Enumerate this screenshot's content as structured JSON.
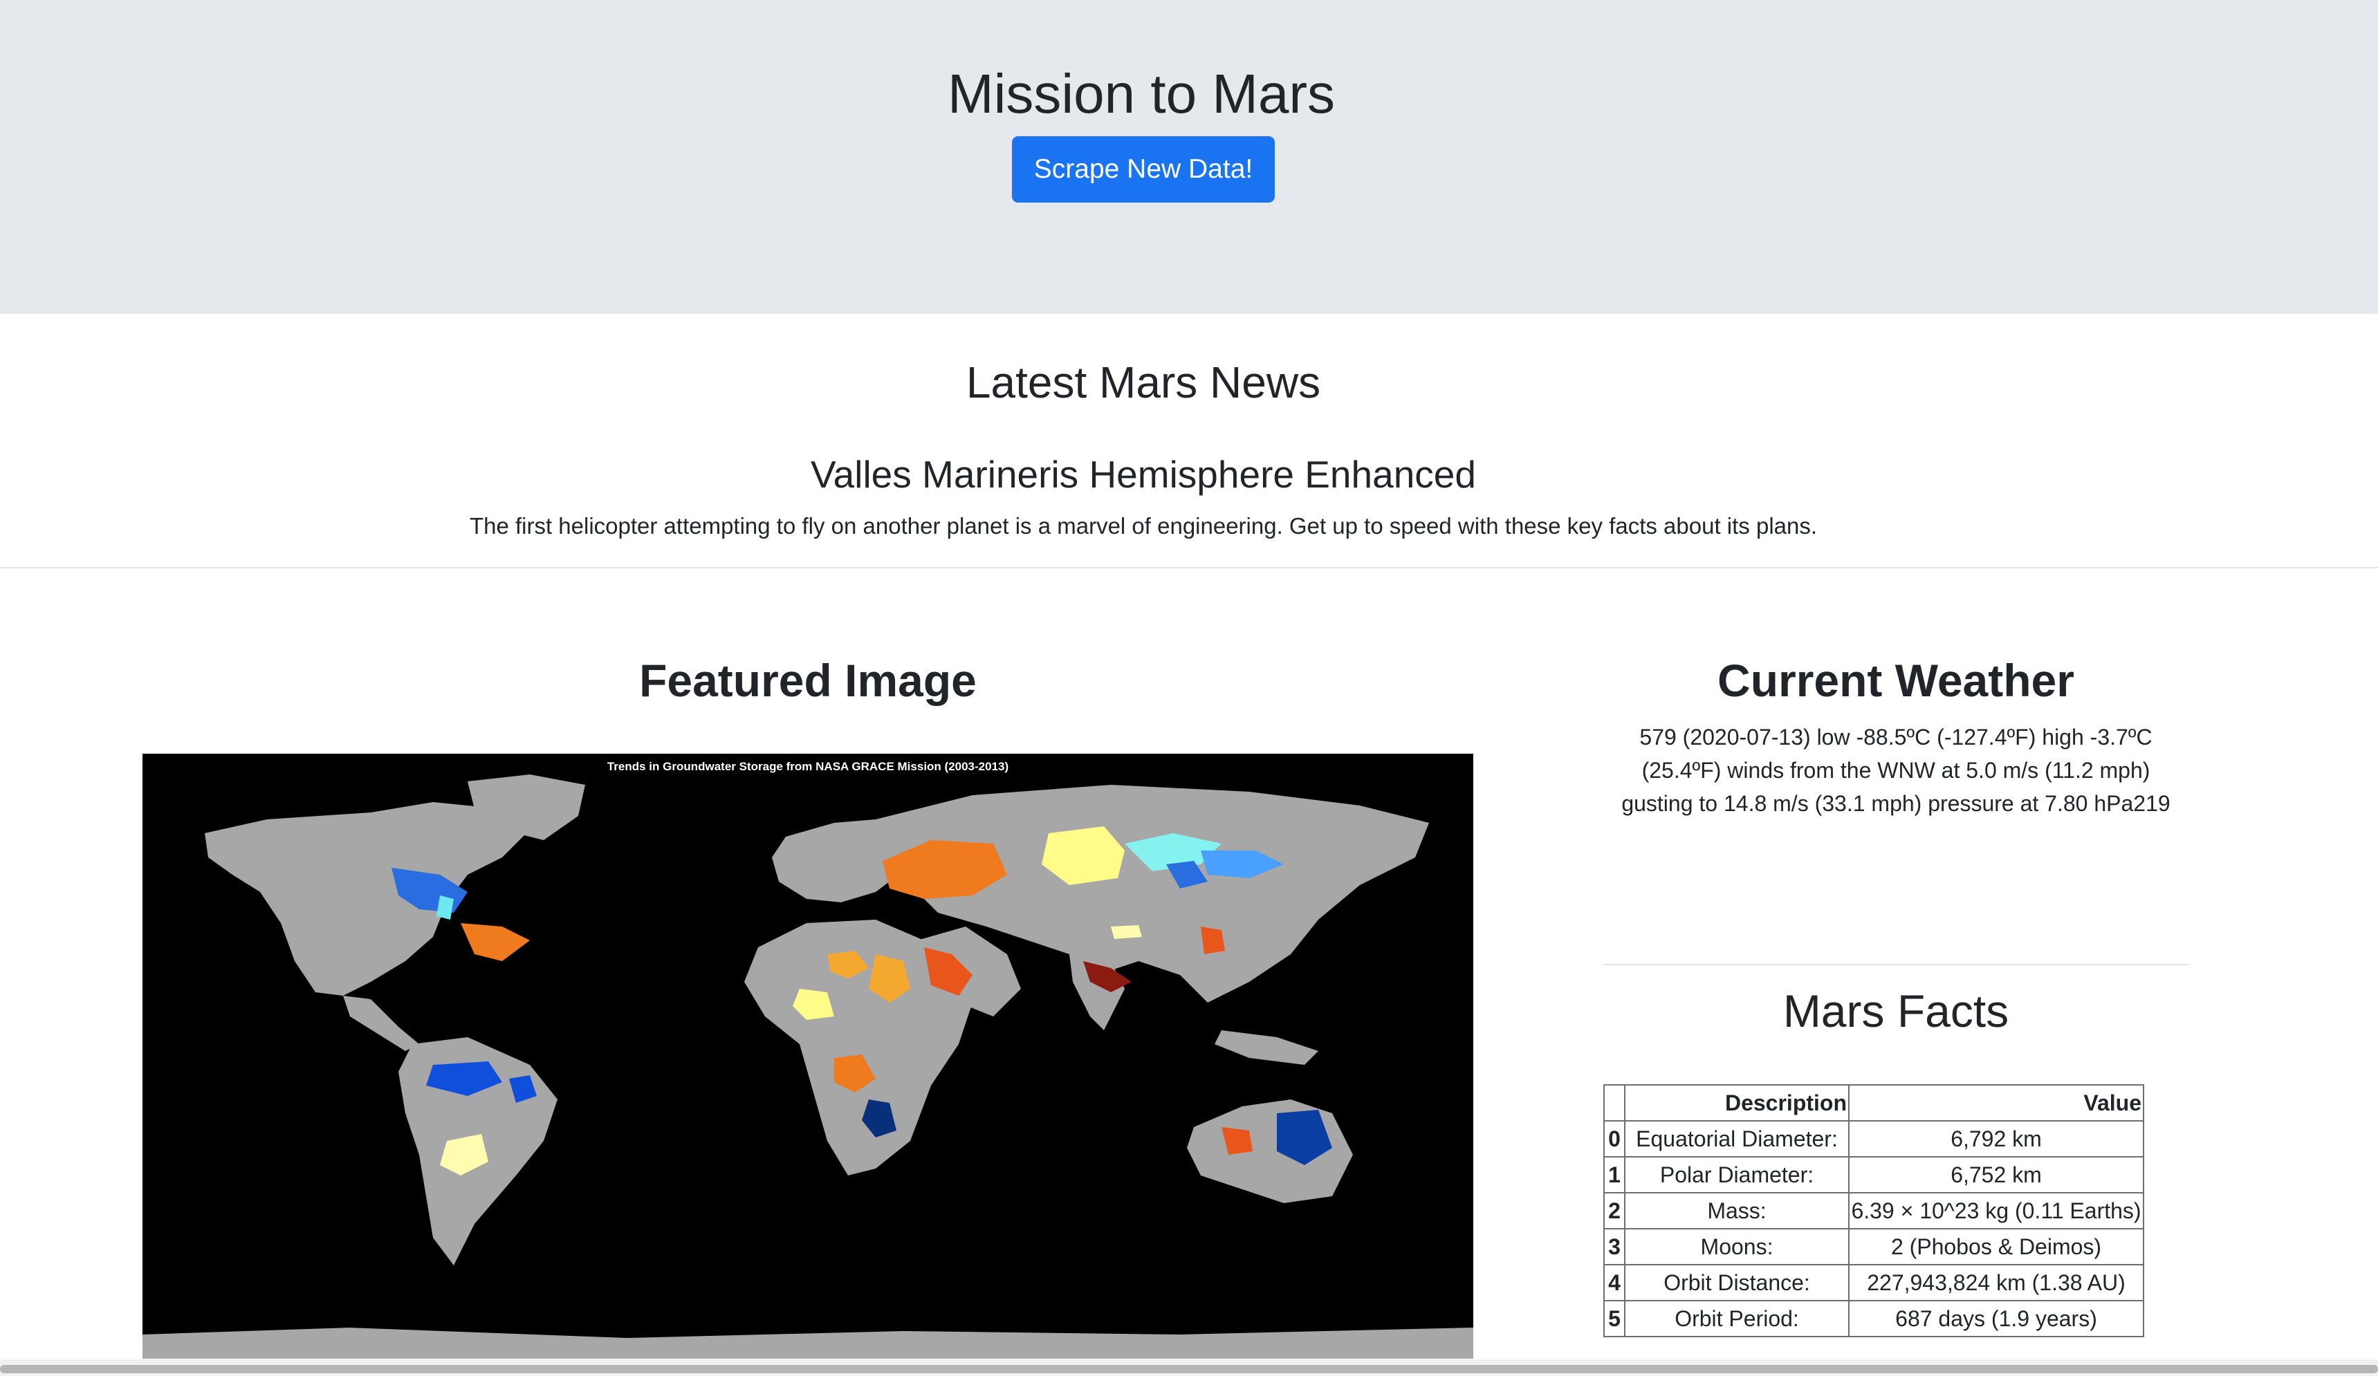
{
  "header": {
    "title": "Mission to Mars",
    "scrape_button": "Scrape New Data!"
  },
  "news": {
    "heading": "Latest Mars News",
    "title": "Valles Marineris Hemisphere Enhanced",
    "teaser": "The first helicopter attempting to fly on another planet is a marvel of engineering. Get up to speed with these key facts about its plans."
  },
  "featured": {
    "heading": "Featured Image",
    "image_caption": "Trends in Groundwater Storage from NASA GRACE Mission (2003-2013)"
  },
  "weather": {
    "heading": "Current Weather",
    "text": "579 (2020-07-13) low -88.5ºC (-127.4ºF) high -3.7ºC (25.4ºF) winds from the WNW at 5.0 m/s (11.2 mph) gusting to 14.8 m/s (33.1 mph) pressure at 7.80 hPa219"
  },
  "facts": {
    "heading": "Mars Facts",
    "columns": {
      "index": "",
      "description": "Description",
      "value": "Value"
    },
    "rows": [
      {
        "idx": "0",
        "desc": "Equatorial Diameter:",
        "val": "6,792 km"
      },
      {
        "idx": "1",
        "desc": "Polar Diameter:",
        "val": "6,752 km"
      },
      {
        "idx": "2",
        "desc": "Mass:",
        "val": "6.39 × 10^23 kg (0.11 Earths)"
      },
      {
        "idx": "3",
        "desc": "Moons:",
        "val": "2 (Phobos & Deimos)"
      },
      {
        "idx": "4",
        "desc": "Orbit Distance:",
        "val": "227,943,824 km (1.38 AU)"
      },
      {
        "idx": "5",
        "desc": "Orbit Period:",
        "val": "687 days (1.9 years)"
      }
    ]
  },
  "colors": {
    "accent": "#1a73f0",
    "jumbotron_bg": "#e5e8ec"
  }
}
